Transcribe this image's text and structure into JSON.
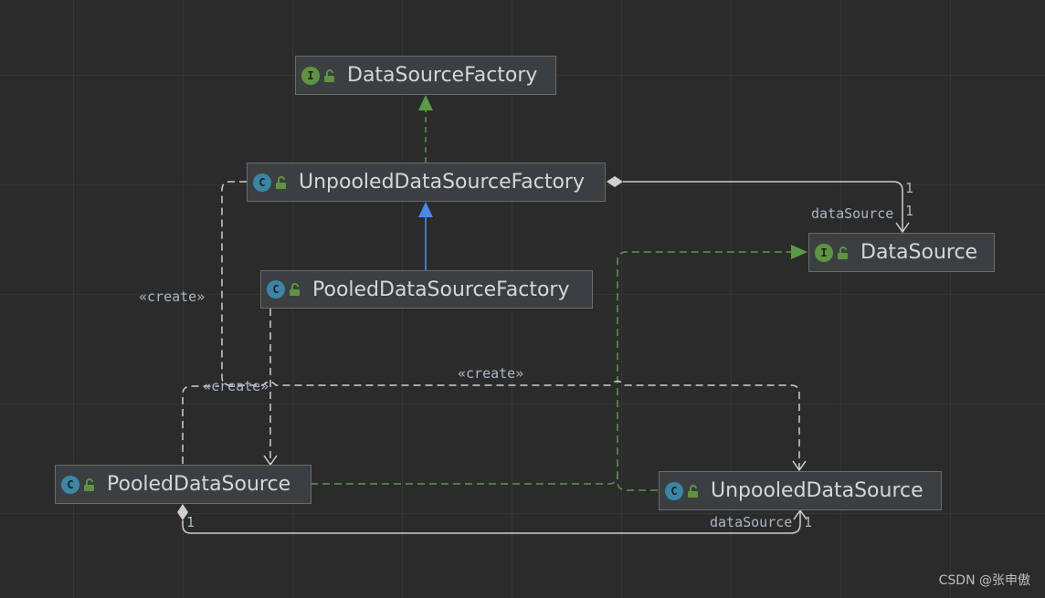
{
  "colors": {
    "background": "#2b2b2b",
    "grid": "#353535",
    "node_fill": "#3c3f41",
    "node_border": "#6b6b6b",
    "node_text": "#d6d6d6",
    "interface_badge": "#5e9441",
    "class_badge": "#3b86a6",
    "realization_edge": "#5a9a47",
    "inheritance_edge": "#4a88e8",
    "plain_edge": "#d0d0d0",
    "label_text": "#a9b7c6"
  },
  "nodes": {
    "datasource_factory": {
      "name": "DataSourceFactory",
      "kind": "I",
      "kind_icon": "interface-icon"
    },
    "unpooled_datasource_factory": {
      "name": "UnpooledDataSourceFactory",
      "kind": "C",
      "kind_icon": "class-icon"
    },
    "pooled_datasource_factory": {
      "name": "PooledDataSourceFactory",
      "kind": "C",
      "kind_icon": "class-icon"
    },
    "datasource": {
      "name": "DataSource",
      "kind": "I",
      "kind_icon": "interface-icon"
    },
    "pooled_datasource": {
      "name": "PooledDataSource",
      "kind": "C",
      "kind_icon": "class-icon"
    },
    "unpooled_datasource": {
      "name": "UnpooledDataSource",
      "kind": "C",
      "kind_icon": "class-icon"
    }
  },
  "edge_labels": {
    "create_left": "«create»",
    "create_middle": "«create»",
    "create_top": "«create»",
    "factory_datasource_role": "dataSource",
    "factory_datasource_mult_source": "1",
    "factory_datasource_mult_target": "1",
    "pooled_unpooled_role": "dataSource",
    "pooled_unpooled_mult_source": "1",
    "pooled_unpooled_mult_target": "1"
  },
  "watermark": "CSDN @张申傲"
}
